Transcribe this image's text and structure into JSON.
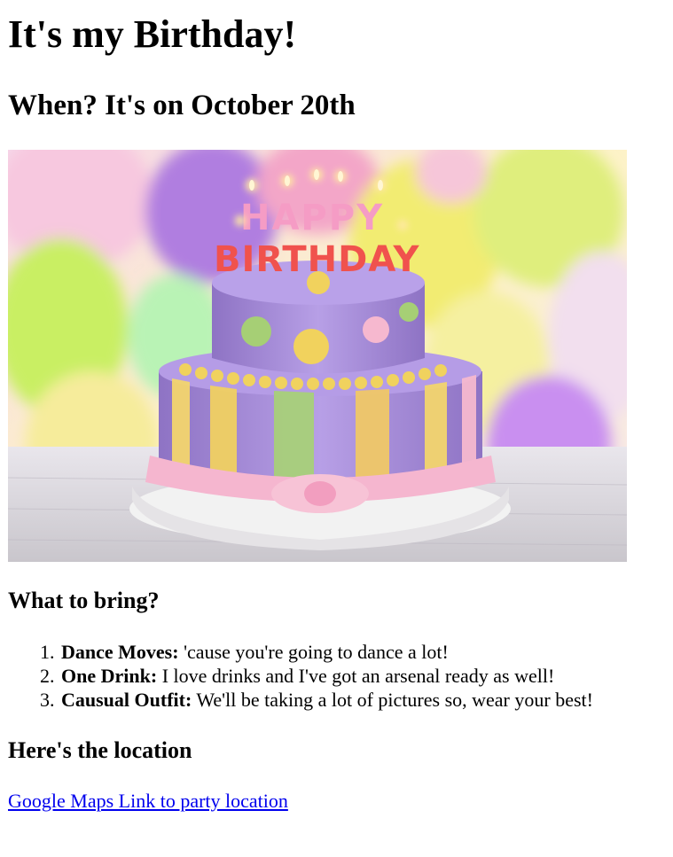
{
  "page": {
    "title": "It's my Birthday!",
    "subtitle": "When? It's on October 20th",
    "image": {
      "description_name": "birthday-cake-photo",
      "candle_text_top": "HAPPY",
      "candle_text_bottom": "BIRTHDAY"
    },
    "bring": {
      "heading": "What to bring?",
      "items": [
        {
          "number": "1.",
          "label": "Dance Moves:",
          "text": " 'cause you're going to dance a lot!"
        },
        {
          "number": "2.",
          "label": "One Drink:",
          "text": " I love drinks and I've got an arsenal ready as well!"
        },
        {
          "number": "3.",
          "label": "Causual Outfit:",
          "text": " We'll be taking a lot of pictures so, wear your best!"
        }
      ]
    },
    "location": {
      "heading": "Here's the location",
      "link_text": "Google Maps Link to party location"
    }
  },
  "colors": {
    "link": "#0000ee",
    "text": "#000000",
    "background": "#ffffff"
  }
}
